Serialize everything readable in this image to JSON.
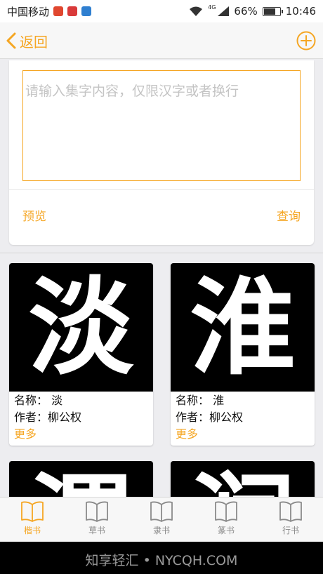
{
  "status_bar": {
    "carrier": "中国移动",
    "network": "4G",
    "battery_text": "66%",
    "battery_level": 0.66,
    "time": "10:46",
    "app_icon_colors": [
      "#e0472f",
      "#d93a3a",
      "#2f7fd0"
    ]
  },
  "nav": {
    "back_label": "返回",
    "add_icon": "plus-circle-icon"
  },
  "input": {
    "placeholder": "请输入集字内容，仅限汉字或者换行",
    "value": ""
  },
  "actions": {
    "preview_label": "预览",
    "query_label": "查询"
  },
  "results": [
    {
      "char": "淡",
      "name_label": "名称：",
      "name": "淡",
      "author_label": "作者：",
      "author": "柳公权",
      "more": "更多"
    },
    {
      "char": "淮",
      "name_label": "名称：",
      "name": "淮",
      "author_label": "作者：",
      "author": "柳公权",
      "more": "更多"
    },
    {
      "char": "渭"
    },
    {
      "char": "润"
    }
  ],
  "tabs": [
    {
      "label": "楷书",
      "icon": "book-icon",
      "active": true
    },
    {
      "label": "草书",
      "icon": "book-icon",
      "active": false
    },
    {
      "label": "隶书",
      "icon": "book-icon",
      "active": false
    },
    {
      "label": "篆书",
      "icon": "book-icon",
      "active": false
    },
    {
      "label": "行书",
      "icon": "book-icon",
      "active": false
    }
  ],
  "watermark": "知享轻汇 • NYCQH.COM",
  "colors": {
    "accent": "#f5a623",
    "inactive": "#888888",
    "card_bg": "#ffffff",
    "char_bg": "#000000"
  }
}
